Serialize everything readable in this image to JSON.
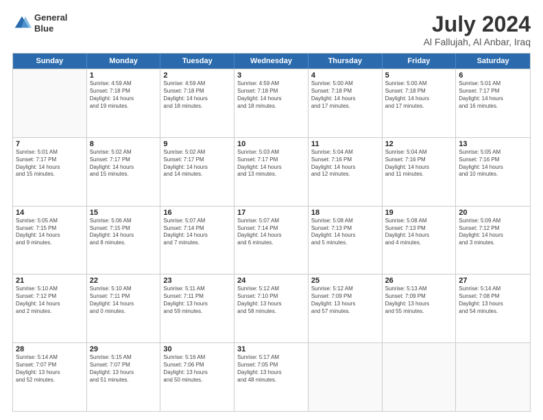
{
  "header": {
    "logo_line1": "General",
    "logo_line2": "Blue",
    "title": "July 2024",
    "subtitle": "Al Fallujah, Al Anbar, Iraq"
  },
  "weekdays": [
    "Sunday",
    "Monday",
    "Tuesday",
    "Wednesday",
    "Thursday",
    "Friday",
    "Saturday"
  ],
  "rows": [
    [
      {
        "day": "",
        "lines": []
      },
      {
        "day": "1",
        "lines": [
          "Sunrise: 4:59 AM",
          "Sunset: 7:18 PM",
          "Daylight: 14 hours",
          "and 19 minutes."
        ]
      },
      {
        "day": "2",
        "lines": [
          "Sunrise: 4:59 AM",
          "Sunset: 7:18 PM",
          "Daylight: 14 hours",
          "and 18 minutes."
        ]
      },
      {
        "day": "3",
        "lines": [
          "Sunrise: 4:59 AM",
          "Sunset: 7:18 PM",
          "Daylight: 14 hours",
          "and 18 minutes."
        ]
      },
      {
        "day": "4",
        "lines": [
          "Sunrise: 5:00 AM",
          "Sunset: 7:18 PM",
          "Daylight: 14 hours",
          "and 17 minutes."
        ]
      },
      {
        "day": "5",
        "lines": [
          "Sunrise: 5:00 AM",
          "Sunset: 7:18 PM",
          "Daylight: 14 hours",
          "and 17 minutes."
        ]
      },
      {
        "day": "6",
        "lines": [
          "Sunrise: 5:01 AM",
          "Sunset: 7:17 PM",
          "Daylight: 14 hours",
          "and 16 minutes."
        ]
      }
    ],
    [
      {
        "day": "7",
        "lines": [
          "Sunrise: 5:01 AM",
          "Sunset: 7:17 PM",
          "Daylight: 14 hours",
          "and 15 minutes."
        ]
      },
      {
        "day": "8",
        "lines": [
          "Sunrise: 5:02 AM",
          "Sunset: 7:17 PM",
          "Daylight: 14 hours",
          "and 15 minutes."
        ]
      },
      {
        "day": "9",
        "lines": [
          "Sunrise: 5:02 AM",
          "Sunset: 7:17 PM",
          "Daylight: 14 hours",
          "and 14 minutes."
        ]
      },
      {
        "day": "10",
        "lines": [
          "Sunrise: 5:03 AM",
          "Sunset: 7:17 PM",
          "Daylight: 14 hours",
          "and 13 minutes."
        ]
      },
      {
        "day": "11",
        "lines": [
          "Sunrise: 5:04 AM",
          "Sunset: 7:16 PM",
          "Daylight: 14 hours",
          "and 12 minutes."
        ]
      },
      {
        "day": "12",
        "lines": [
          "Sunrise: 5:04 AM",
          "Sunset: 7:16 PM",
          "Daylight: 14 hours",
          "and 11 minutes."
        ]
      },
      {
        "day": "13",
        "lines": [
          "Sunrise: 5:05 AM",
          "Sunset: 7:16 PM",
          "Daylight: 14 hours",
          "and 10 minutes."
        ]
      }
    ],
    [
      {
        "day": "14",
        "lines": [
          "Sunrise: 5:05 AM",
          "Sunset: 7:15 PM",
          "Daylight: 14 hours",
          "and 9 minutes."
        ]
      },
      {
        "day": "15",
        "lines": [
          "Sunrise: 5:06 AM",
          "Sunset: 7:15 PM",
          "Daylight: 14 hours",
          "and 8 minutes."
        ]
      },
      {
        "day": "16",
        "lines": [
          "Sunrise: 5:07 AM",
          "Sunset: 7:14 PM",
          "Daylight: 14 hours",
          "and 7 minutes."
        ]
      },
      {
        "day": "17",
        "lines": [
          "Sunrise: 5:07 AM",
          "Sunset: 7:14 PM",
          "Daylight: 14 hours",
          "and 6 minutes."
        ]
      },
      {
        "day": "18",
        "lines": [
          "Sunrise: 5:08 AM",
          "Sunset: 7:13 PM",
          "Daylight: 14 hours",
          "and 5 minutes."
        ]
      },
      {
        "day": "19",
        "lines": [
          "Sunrise: 5:08 AM",
          "Sunset: 7:13 PM",
          "Daylight: 14 hours",
          "and 4 minutes."
        ]
      },
      {
        "day": "20",
        "lines": [
          "Sunrise: 5:09 AM",
          "Sunset: 7:12 PM",
          "Daylight: 14 hours",
          "and 3 minutes."
        ]
      }
    ],
    [
      {
        "day": "21",
        "lines": [
          "Sunrise: 5:10 AM",
          "Sunset: 7:12 PM",
          "Daylight: 14 hours",
          "and 2 minutes."
        ]
      },
      {
        "day": "22",
        "lines": [
          "Sunrise: 5:10 AM",
          "Sunset: 7:11 PM",
          "Daylight: 14 hours",
          "and 0 minutes."
        ]
      },
      {
        "day": "23",
        "lines": [
          "Sunrise: 5:11 AM",
          "Sunset: 7:11 PM",
          "Daylight: 13 hours",
          "and 59 minutes."
        ]
      },
      {
        "day": "24",
        "lines": [
          "Sunrise: 5:12 AM",
          "Sunset: 7:10 PM",
          "Daylight: 13 hours",
          "and 58 minutes."
        ]
      },
      {
        "day": "25",
        "lines": [
          "Sunrise: 5:12 AM",
          "Sunset: 7:09 PM",
          "Daylight: 13 hours",
          "and 57 minutes."
        ]
      },
      {
        "day": "26",
        "lines": [
          "Sunrise: 5:13 AM",
          "Sunset: 7:09 PM",
          "Daylight: 13 hours",
          "and 55 minutes."
        ]
      },
      {
        "day": "27",
        "lines": [
          "Sunrise: 5:14 AM",
          "Sunset: 7:08 PM",
          "Daylight: 13 hours",
          "and 54 minutes."
        ]
      }
    ],
    [
      {
        "day": "28",
        "lines": [
          "Sunrise: 5:14 AM",
          "Sunset: 7:07 PM",
          "Daylight: 13 hours",
          "and 52 minutes."
        ]
      },
      {
        "day": "29",
        "lines": [
          "Sunrise: 5:15 AM",
          "Sunset: 7:07 PM",
          "Daylight: 13 hours",
          "and 51 minutes."
        ]
      },
      {
        "day": "30",
        "lines": [
          "Sunrise: 5:16 AM",
          "Sunset: 7:06 PM",
          "Daylight: 13 hours",
          "and 50 minutes."
        ]
      },
      {
        "day": "31",
        "lines": [
          "Sunrise: 5:17 AM",
          "Sunset: 7:05 PM",
          "Daylight: 13 hours",
          "and 48 minutes."
        ]
      },
      {
        "day": "",
        "lines": []
      },
      {
        "day": "",
        "lines": []
      },
      {
        "day": "",
        "lines": []
      }
    ]
  ]
}
